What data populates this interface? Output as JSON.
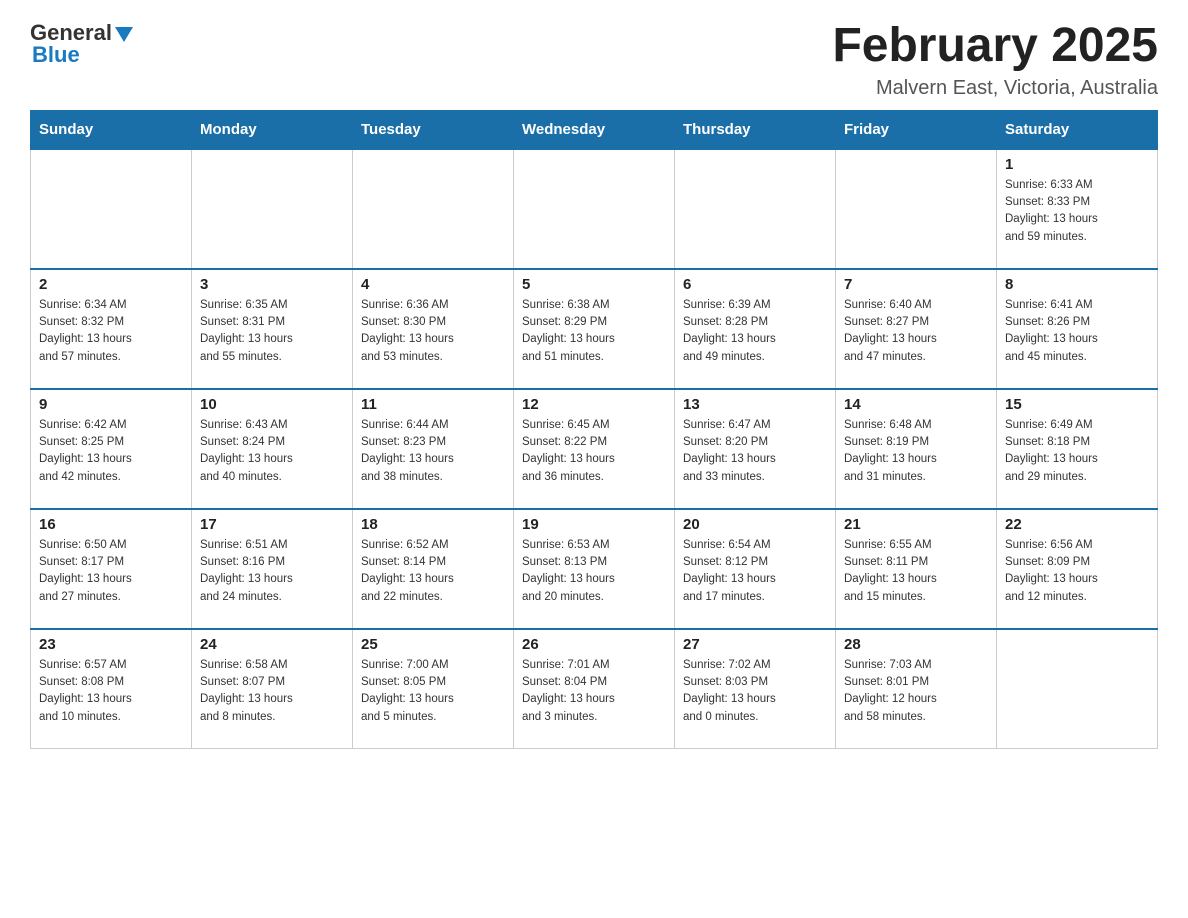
{
  "header": {
    "logo_general": "General",
    "logo_blue": "Blue",
    "title": "February 2025",
    "subtitle": "Malvern East, Victoria, Australia"
  },
  "calendar": {
    "days_of_week": [
      "Sunday",
      "Monday",
      "Tuesday",
      "Wednesday",
      "Thursday",
      "Friday",
      "Saturday"
    ],
    "weeks": [
      [
        {
          "day": "",
          "info": ""
        },
        {
          "day": "",
          "info": ""
        },
        {
          "day": "",
          "info": ""
        },
        {
          "day": "",
          "info": ""
        },
        {
          "day": "",
          "info": ""
        },
        {
          "day": "",
          "info": ""
        },
        {
          "day": "1",
          "info": "Sunrise: 6:33 AM\nSunset: 8:33 PM\nDaylight: 13 hours\nand 59 minutes."
        }
      ],
      [
        {
          "day": "2",
          "info": "Sunrise: 6:34 AM\nSunset: 8:32 PM\nDaylight: 13 hours\nand 57 minutes."
        },
        {
          "day": "3",
          "info": "Sunrise: 6:35 AM\nSunset: 8:31 PM\nDaylight: 13 hours\nand 55 minutes."
        },
        {
          "day": "4",
          "info": "Sunrise: 6:36 AM\nSunset: 8:30 PM\nDaylight: 13 hours\nand 53 minutes."
        },
        {
          "day": "5",
          "info": "Sunrise: 6:38 AM\nSunset: 8:29 PM\nDaylight: 13 hours\nand 51 minutes."
        },
        {
          "day": "6",
          "info": "Sunrise: 6:39 AM\nSunset: 8:28 PM\nDaylight: 13 hours\nand 49 minutes."
        },
        {
          "day": "7",
          "info": "Sunrise: 6:40 AM\nSunset: 8:27 PM\nDaylight: 13 hours\nand 47 minutes."
        },
        {
          "day": "8",
          "info": "Sunrise: 6:41 AM\nSunset: 8:26 PM\nDaylight: 13 hours\nand 45 minutes."
        }
      ],
      [
        {
          "day": "9",
          "info": "Sunrise: 6:42 AM\nSunset: 8:25 PM\nDaylight: 13 hours\nand 42 minutes."
        },
        {
          "day": "10",
          "info": "Sunrise: 6:43 AM\nSunset: 8:24 PM\nDaylight: 13 hours\nand 40 minutes."
        },
        {
          "day": "11",
          "info": "Sunrise: 6:44 AM\nSunset: 8:23 PM\nDaylight: 13 hours\nand 38 minutes."
        },
        {
          "day": "12",
          "info": "Sunrise: 6:45 AM\nSunset: 8:22 PM\nDaylight: 13 hours\nand 36 minutes."
        },
        {
          "day": "13",
          "info": "Sunrise: 6:47 AM\nSunset: 8:20 PM\nDaylight: 13 hours\nand 33 minutes."
        },
        {
          "day": "14",
          "info": "Sunrise: 6:48 AM\nSunset: 8:19 PM\nDaylight: 13 hours\nand 31 minutes."
        },
        {
          "day": "15",
          "info": "Sunrise: 6:49 AM\nSunset: 8:18 PM\nDaylight: 13 hours\nand 29 minutes."
        }
      ],
      [
        {
          "day": "16",
          "info": "Sunrise: 6:50 AM\nSunset: 8:17 PM\nDaylight: 13 hours\nand 27 minutes."
        },
        {
          "day": "17",
          "info": "Sunrise: 6:51 AM\nSunset: 8:16 PM\nDaylight: 13 hours\nand 24 minutes."
        },
        {
          "day": "18",
          "info": "Sunrise: 6:52 AM\nSunset: 8:14 PM\nDaylight: 13 hours\nand 22 minutes."
        },
        {
          "day": "19",
          "info": "Sunrise: 6:53 AM\nSunset: 8:13 PM\nDaylight: 13 hours\nand 20 minutes."
        },
        {
          "day": "20",
          "info": "Sunrise: 6:54 AM\nSunset: 8:12 PM\nDaylight: 13 hours\nand 17 minutes."
        },
        {
          "day": "21",
          "info": "Sunrise: 6:55 AM\nSunset: 8:11 PM\nDaylight: 13 hours\nand 15 minutes."
        },
        {
          "day": "22",
          "info": "Sunrise: 6:56 AM\nSunset: 8:09 PM\nDaylight: 13 hours\nand 12 minutes."
        }
      ],
      [
        {
          "day": "23",
          "info": "Sunrise: 6:57 AM\nSunset: 8:08 PM\nDaylight: 13 hours\nand 10 minutes."
        },
        {
          "day": "24",
          "info": "Sunrise: 6:58 AM\nSunset: 8:07 PM\nDaylight: 13 hours\nand 8 minutes."
        },
        {
          "day": "25",
          "info": "Sunrise: 7:00 AM\nSunset: 8:05 PM\nDaylight: 13 hours\nand 5 minutes."
        },
        {
          "day": "26",
          "info": "Sunrise: 7:01 AM\nSunset: 8:04 PM\nDaylight: 13 hours\nand 3 minutes."
        },
        {
          "day": "27",
          "info": "Sunrise: 7:02 AM\nSunset: 8:03 PM\nDaylight: 13 hours\nand 0 minutes."
        },
        {
          "day": "28",
          "info": "Sunrise: 7:03 AM\nSunset: 8:01 PM\nDaylight: 12 hours\nand 58 minutes."
        },
        {
          "day": "",
          "info": ""
        }
      ]
    ]
  }
}
